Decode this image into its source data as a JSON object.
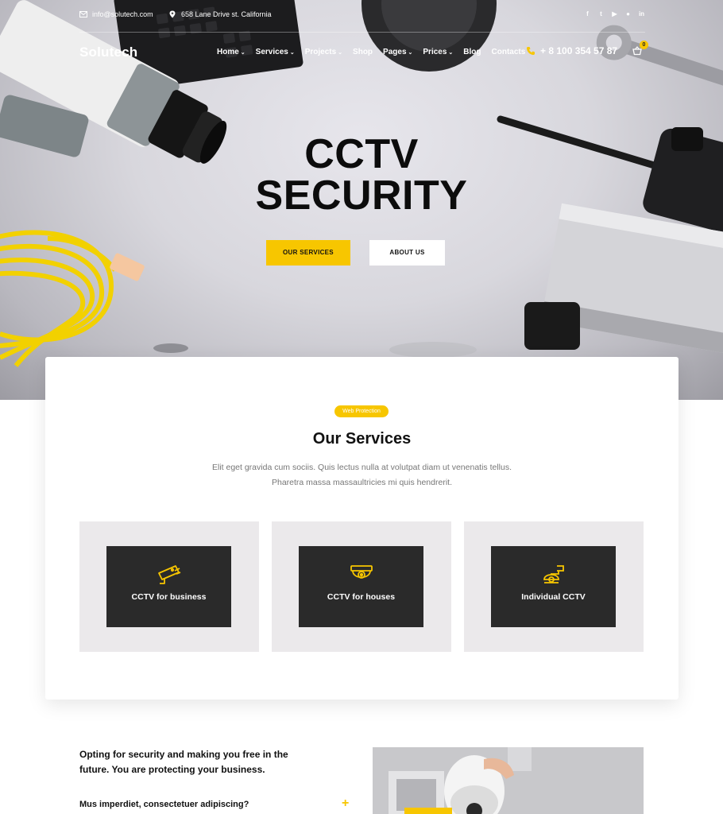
{
  "topbar": {
    "email": "info@solutech.com",
    "address": "658 Lane Drive st. California",
    "socials": [
      "facebook-icon",
      "twitter-icon",
      "youtube-icon",
      "github-icon",
      "linkedin-icon"
    ]
  },
  "nav": {
    "logo": "Solutech",
    "items": [
      {
        "label": "Home",
        "dropdown": true
      },
      {
        "label": "Services",
        "dropdown": true
      },
      {
        "label": "Projects",
        "dropdown": true
      },
      {
        "label": "Shop",
        "dropdown": false
      },
      {
        "label": "Pages",
        "dropdown": true
      },
      {
        "label": "Prices",
        "dropdown": true
      },
      {
        "label": "Blog",
        "dropdown": false
      },
      {
        "label": "Contacts",
        "dropdown": false
      }
    ],
    "phone": "+ 8 100 354 57 87",
    "cart_count": "0"
  },
  "hero": {
    "title_line1": "CCTV",
    "title_line2": "SECURITY",
    "primary_button": "OUR SERVICES",
    "secondary_button": "ABOUT US"
  },
  "services": {
    "badge": "Web Protection",
    "title": "Our Services",
    "desc_line1": "Elit eget gravida cum sociis. Quis lectus nulla at volutpat diam ut venenatis tellus.",
    "desc_line2": "Pharetra massa massaultricies mi quis hendrerit.",
    "items": [
      {
        "label": "CCTV for business",
        "icon": "cctv-camera-icon"
      },
      {
        "label": "CCTV for houses",
        "icon": "dome-camera-icon"
      },
      {
        "label": "Individual CCTV",
        "icon": "ptz-camera-icon"
      }
    ]
  },
  "about": {
    "lead": "Opting for security and making you free in the future. You are protecting your business.",
    "faq_question": "Mus imperdiet, consectetuer adipiscing?",
    "faq_toggle": "+"
  },
  "colors": {
    "accent": "#f7c600",
    "dark_card": "#2a2a2a",
    "service_bg": "#ebe9eb"
  }
}
